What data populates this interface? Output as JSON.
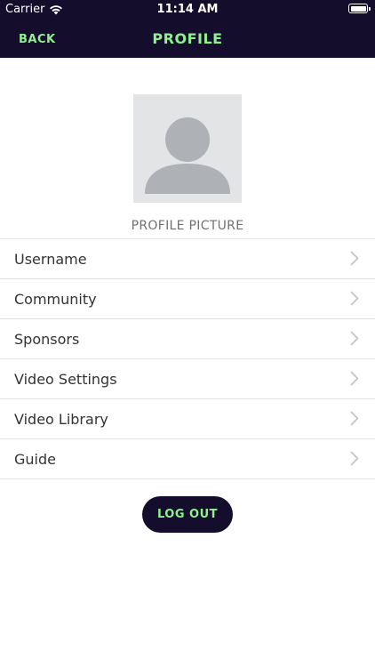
{
  "status_bar": {
    "carrier": "Carrier",
    "time": "11:14 AM"
  },
  "nav": {
    "back_label": "BACK",
    "title": "PROFILE"
  },
  "profile": {
    "picture_label": "PROFILE PICTURE"
  },
  "menu": {
    "items": [
      {
        "label": "Username"
      },
      {
        "label": "Community"
      },
      {
        "label": "Sponsors"
      },
      {
        "label": "Video Settings"
      },
      {
        "label": "Video Library"
      },
      {
        "label": "Guide"
      }
    ]
  },
  "actions": {
    "logout_label": "LOG OUT"
  },
  "colors": {
    "header_bg": "#140d2b",
    "accent": "#8ef08e",
    "divider": "#e2e2e2"
  },
  "icons": {
    "wifi": "wifi-icon",
    "battery": "battery-icon",
    "avatar": "avatar-placeholder-icon",
    "chevron": "chevron-right-icon"
  }
}
